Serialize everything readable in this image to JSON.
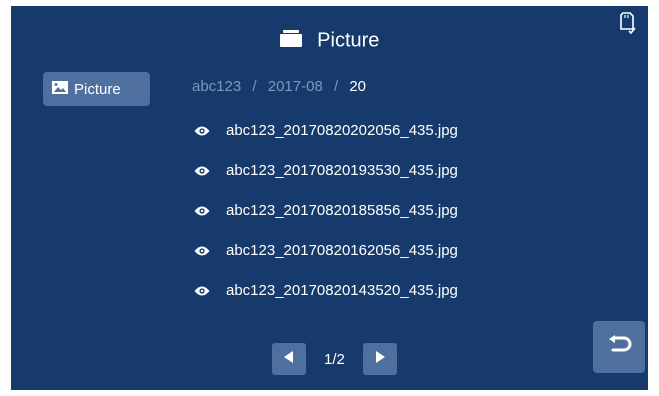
{
  "header": {
    "title": "Picture",
    "folder_icon": "folder-icon"
  },
  "status": {
    "storage_icon": "sd-card-icon"
  },
  "sidebar": {
    "items": [
      {
        "label": "Picture",
        "icon": "image-icon"
      }
    ]
  },
  "breadcrumb": {
    "device": "abc123",
    "month": "2017-08",
    "day": "20",
    "separator": "/"
  },
  "files": [
    {
      "name": "abc123_20170820202056_435.jpg"
    },
    {
      "name": "abc123_20170820193530_435.jpg"
    },
    {
      "name": "abc123_20170820185856_435.jpg"
    },
    {
      "name": "abc123_20170820162056_435.jpg"
    },
    {
      "name": "abc123_20170820143520_435.jpg"
    }
  ],
  "pager": {
    "page_label": "1/2"
  },
  "colors": {
    "background": "#163a6b",
    "button": "#4f6f9f",
    "text": "#ffffff",
    "muted_text": "#7d96bd"
  }
}
